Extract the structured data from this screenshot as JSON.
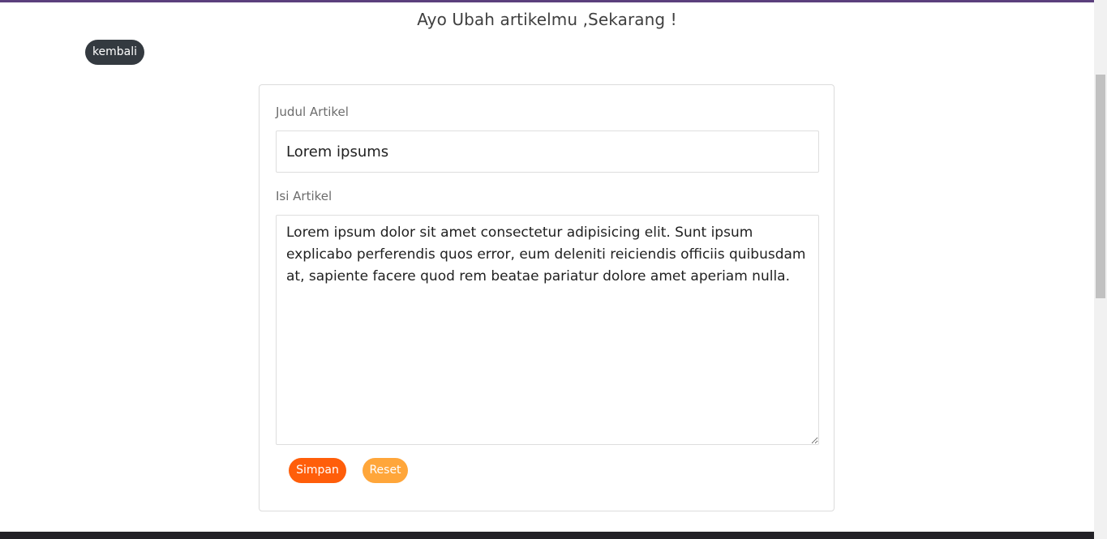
{
  "header": {
    "title": "Ayo Ubah artikelmu ,Sekarang !"
  },
  "nav": {
    "back_label": "kembali"
  },
  "form": {
    "title_label": "Judul Artikel",
    "title_value": "Lorem ipsums",
    "content_label": "Isi Artikel",
    "content_value": "Lorem ipsum dolor sit amet consectetur adipisicing elit. Sunt ipsum explicabo perferendis quos error, eum deleniti reiciendis officiis quibusdam at, sapiente facere quod rem beatae pariatur dolore amet aperiam nulla.",
    "save_label": "Simpan",
    "reset_label": "Reset"
  },
  "colors": {
    "accent_top": "#5b3f7d",
    "back_button": "#343a40",
    "save_button": "#ff5e0a",
    "reset_button": "#ffa63a",
    "footer": "#222126"
  }
}
